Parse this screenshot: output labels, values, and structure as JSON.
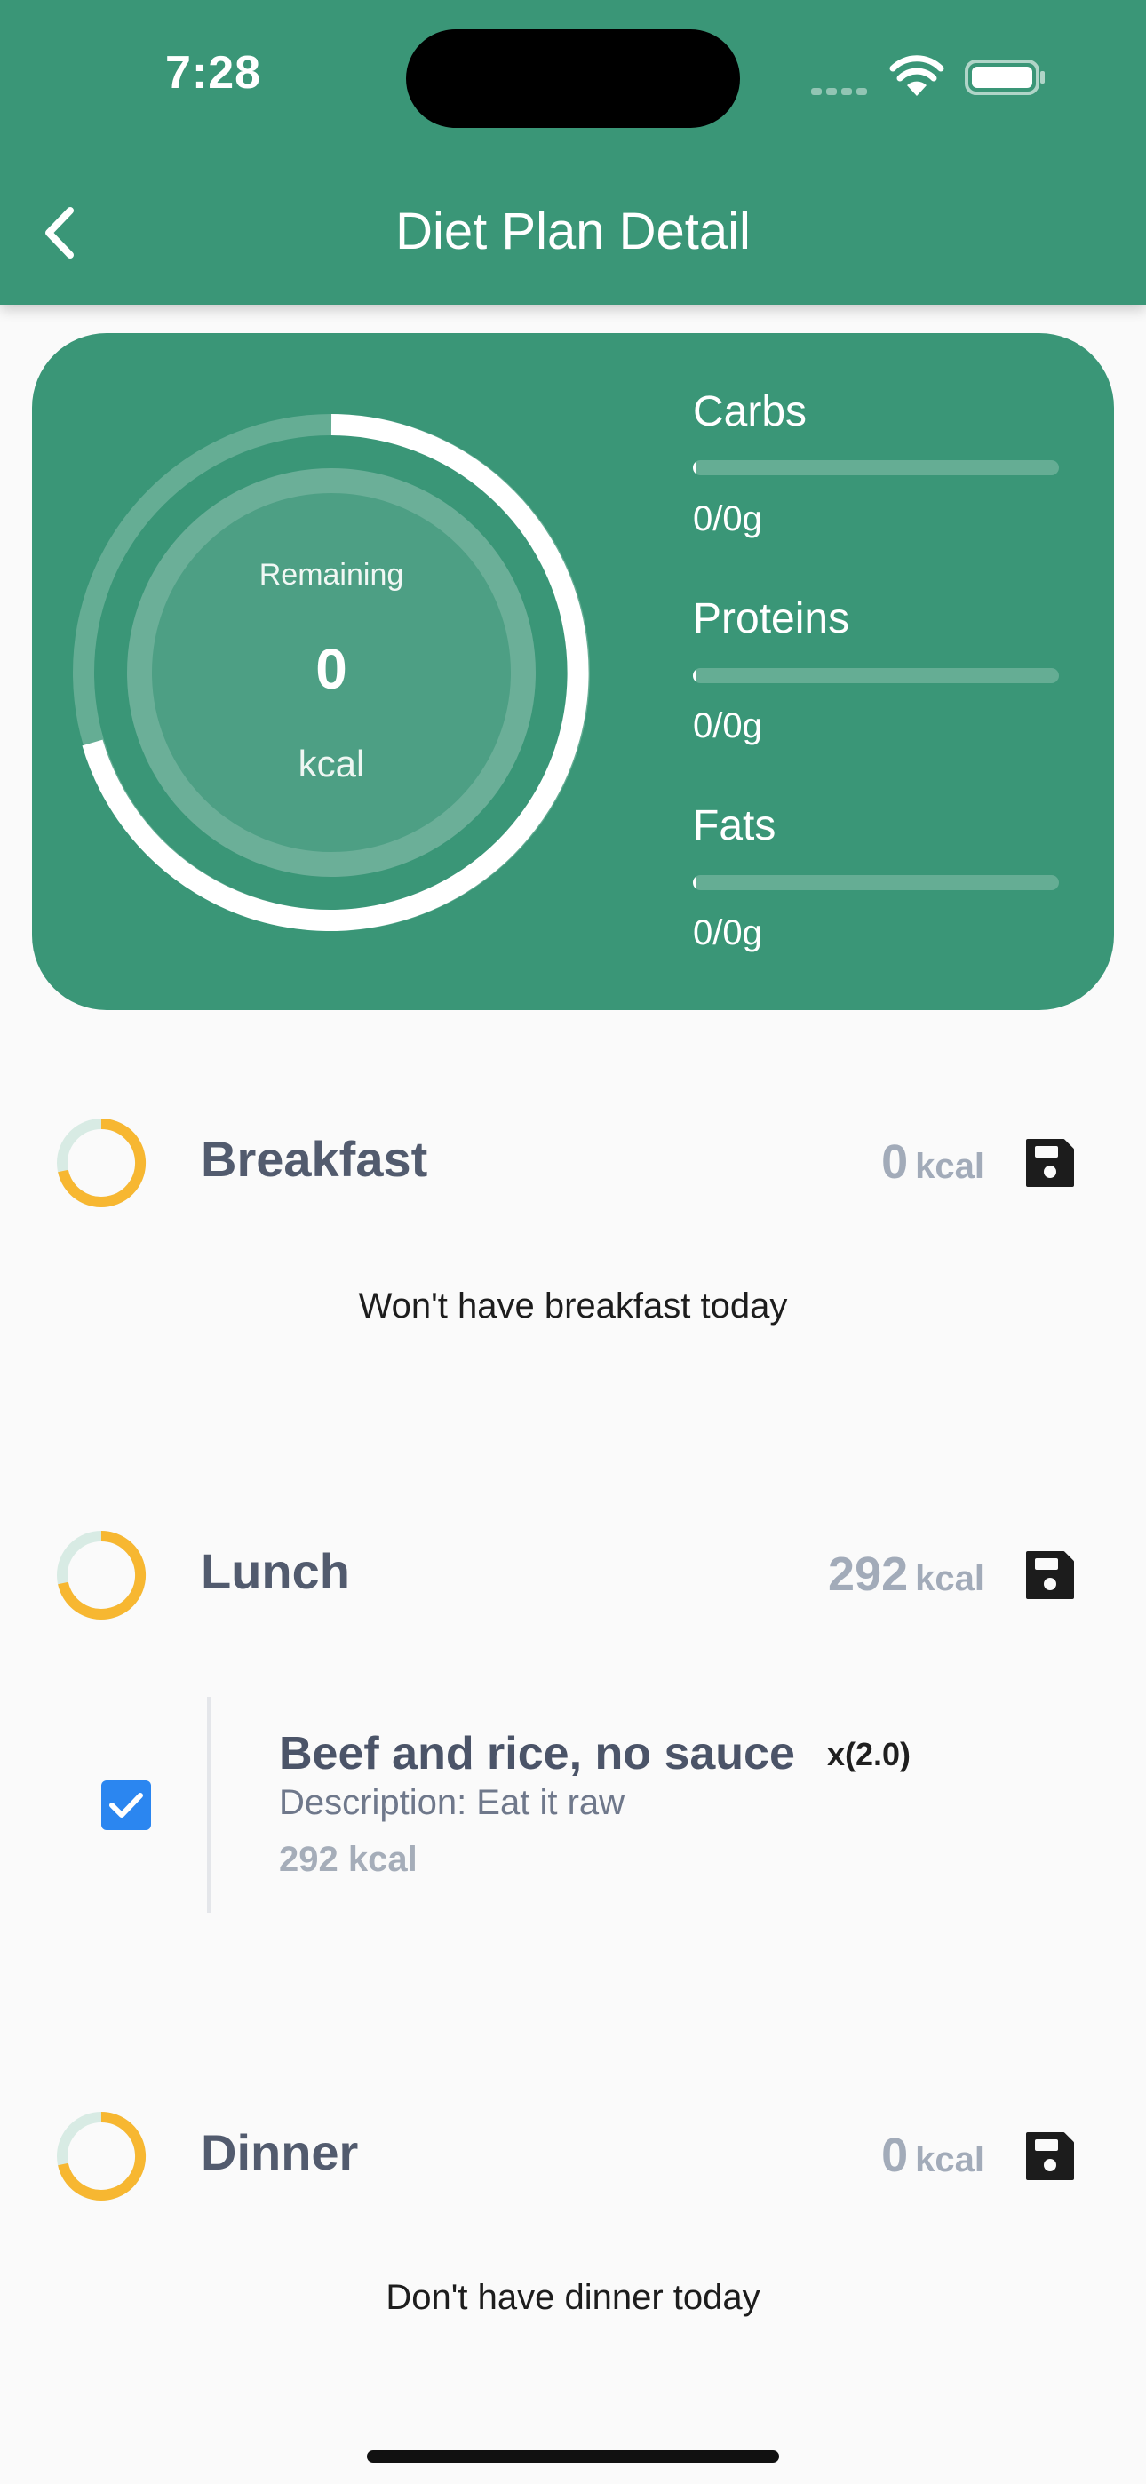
{
  "status_bar": {
    "time": "7:28"
  },
  "app_bar": {
    "title": "Diet Plan Detail"
  },
  "summary": {
    "remaining_label": "Remaining",
    "remaining_value": "0",
    "remaining_unit": "kcal",
    "macros": [
      {
        "label": "Carbs",
        "value": "0/0g"
      },
      {
        "label": "Proteins",
        "value": "0/0g"
      },
      {
        "label": "Fats",
        "value": "0/0g"
      }
    ]
  },
  "meals": [
    {
      "title": "Breakfast",
      "kcal": "0",
      "unit": "kcal",
      "empty_message": "Won't have breakfast today"
    },
    {
      "title": "Lunch",
      "kcal": "292",
      "unit": "kcal",
      "foods": [
        {
          "name": "Beef and rice, no sauce",
          "quantity": "x(2.0)",
          "description": "Description: Eat it raw",
          "kcal": "292 kcal",
          "checked": true
        }
      ]
    },
    {
      "title": "Dinner",
      "kcal": "0",
      "unit": "kcal",
      "empty_message": "Don't have dinner today"
    }
  ],
  "colors": {
    "primary": "#3a9677",
    "meal_ring_accent": "#f7b731",
    "meal_ring_track": "#d8ebe4",
    "checkbox": "#2b86f0",
    "meal_title": "#525b6e"
  }
}
